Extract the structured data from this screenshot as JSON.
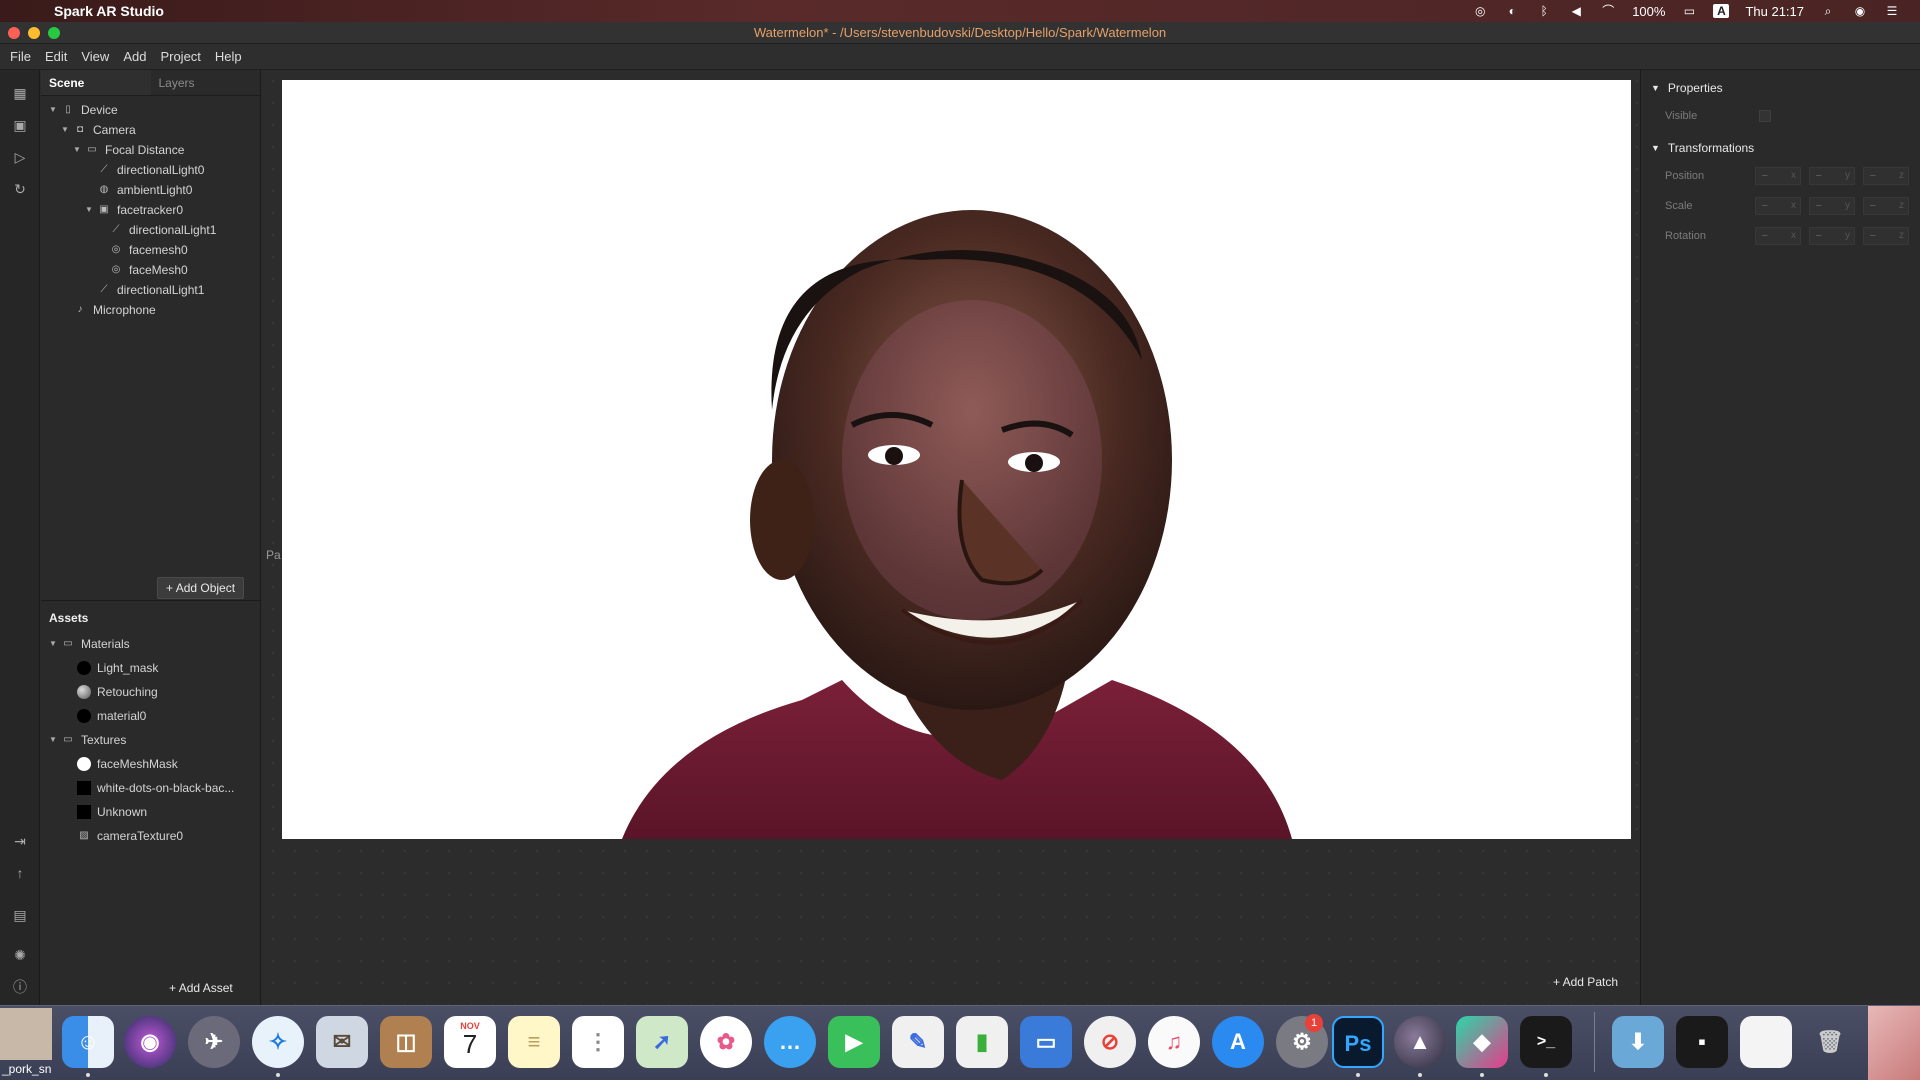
{
  "menubar": {
    "app_name": "Spark AR Studio",
    "battery": "100%",
    "clock": "Thu 21:17",
    "input_indicator": "A"
  },
  "window": {
    "title": "Watermelon* - /Users/stevenbudovski/Desktop/Hello/Spark/Watermelon"
  },
  "app_menu": [
    "File",
    "Edit",
    "View",
    "Add",
    "Project",
    "Help"
  ],
  "scene_panel": {
    "tabs": [
      "Scene",
      "Layers"
    ],
    "tree": [
      {
        "label": "Device",
        "icon": "device-icon"
      },
      {
        "label": "Camera",
        "icon": "camera-icon"
      },
      {
        "label": "Focal Distance",
        "icon": "focal-distance-icon"
      },
      {
        "label": "directionalLight0",
        "icon": "directional-light-icon"
      },
      {
        "label": "ambientLight0",
        "icon": "ambient-light-icon"
      },
      {
        "label": "facetracker0",
        "icon": "facetracker-icon"
      },
      {
        "label": "directionalLight1",
        "icon": "directional-light-icon"
      },
      {
        "label": "facemesh0",
        "icon": "facemesh-icon"
      },
      {
        "label": "faceMesh0",
        "icon": "facemesh-icon"
      },
      {
        "label": "directionalLight1",
        "icon": "directional-light-icon"
      },
      {
        "label": "Microphone",
        "icon": "microphone-icon"
      }
    ],
    "add_object_label": "Add Object"
  },
  "assets_panel": {
    "title": "Assets",
    "groups": [
      {
        "label": "Materials",
        "items": [
          "Light_mask",
          "Retouching",
          "material0"
        ]
      },
      {
        "label": "Textures",
        "items": [
          "faceMeshMask",
          "white-dots-on-black-bac...",
          "Unknown",
          "cameraTexture0"
        ]
      }
    ],
    "add_asset_label": "Add Asset"
  },
  "viewport": {
    "patch_editor_label": "Pa",
    "add_patch_label": "Add Patch"
  },
  "properties": {
    "title": "Properties",
    "visible_label": "Visible",
    "transformations_title": "Transformations",
    "rows": [
      {
        "label": "Position"
      },
      {
        "label": "Scale"
      },
      {
        "label": "Rotation"
      }
    ],
    "placeholder": "–",
    "axes": [
      "x",
      "y",
      "z"
    ]
  },
  "dock": {
    "calendar_month": "NOV",
    "calendar_day": "7",
    "settings_badge": "1",
    "photoshop_label": "Ps",
    "finder_partial_label": "_pork_sn"
  },
  "colors": {
    "title_text": "#e6a06a",
    "panel_bg": "#2a2a2a",
    "viewport_canvas": "#ffffff"
  }
}
